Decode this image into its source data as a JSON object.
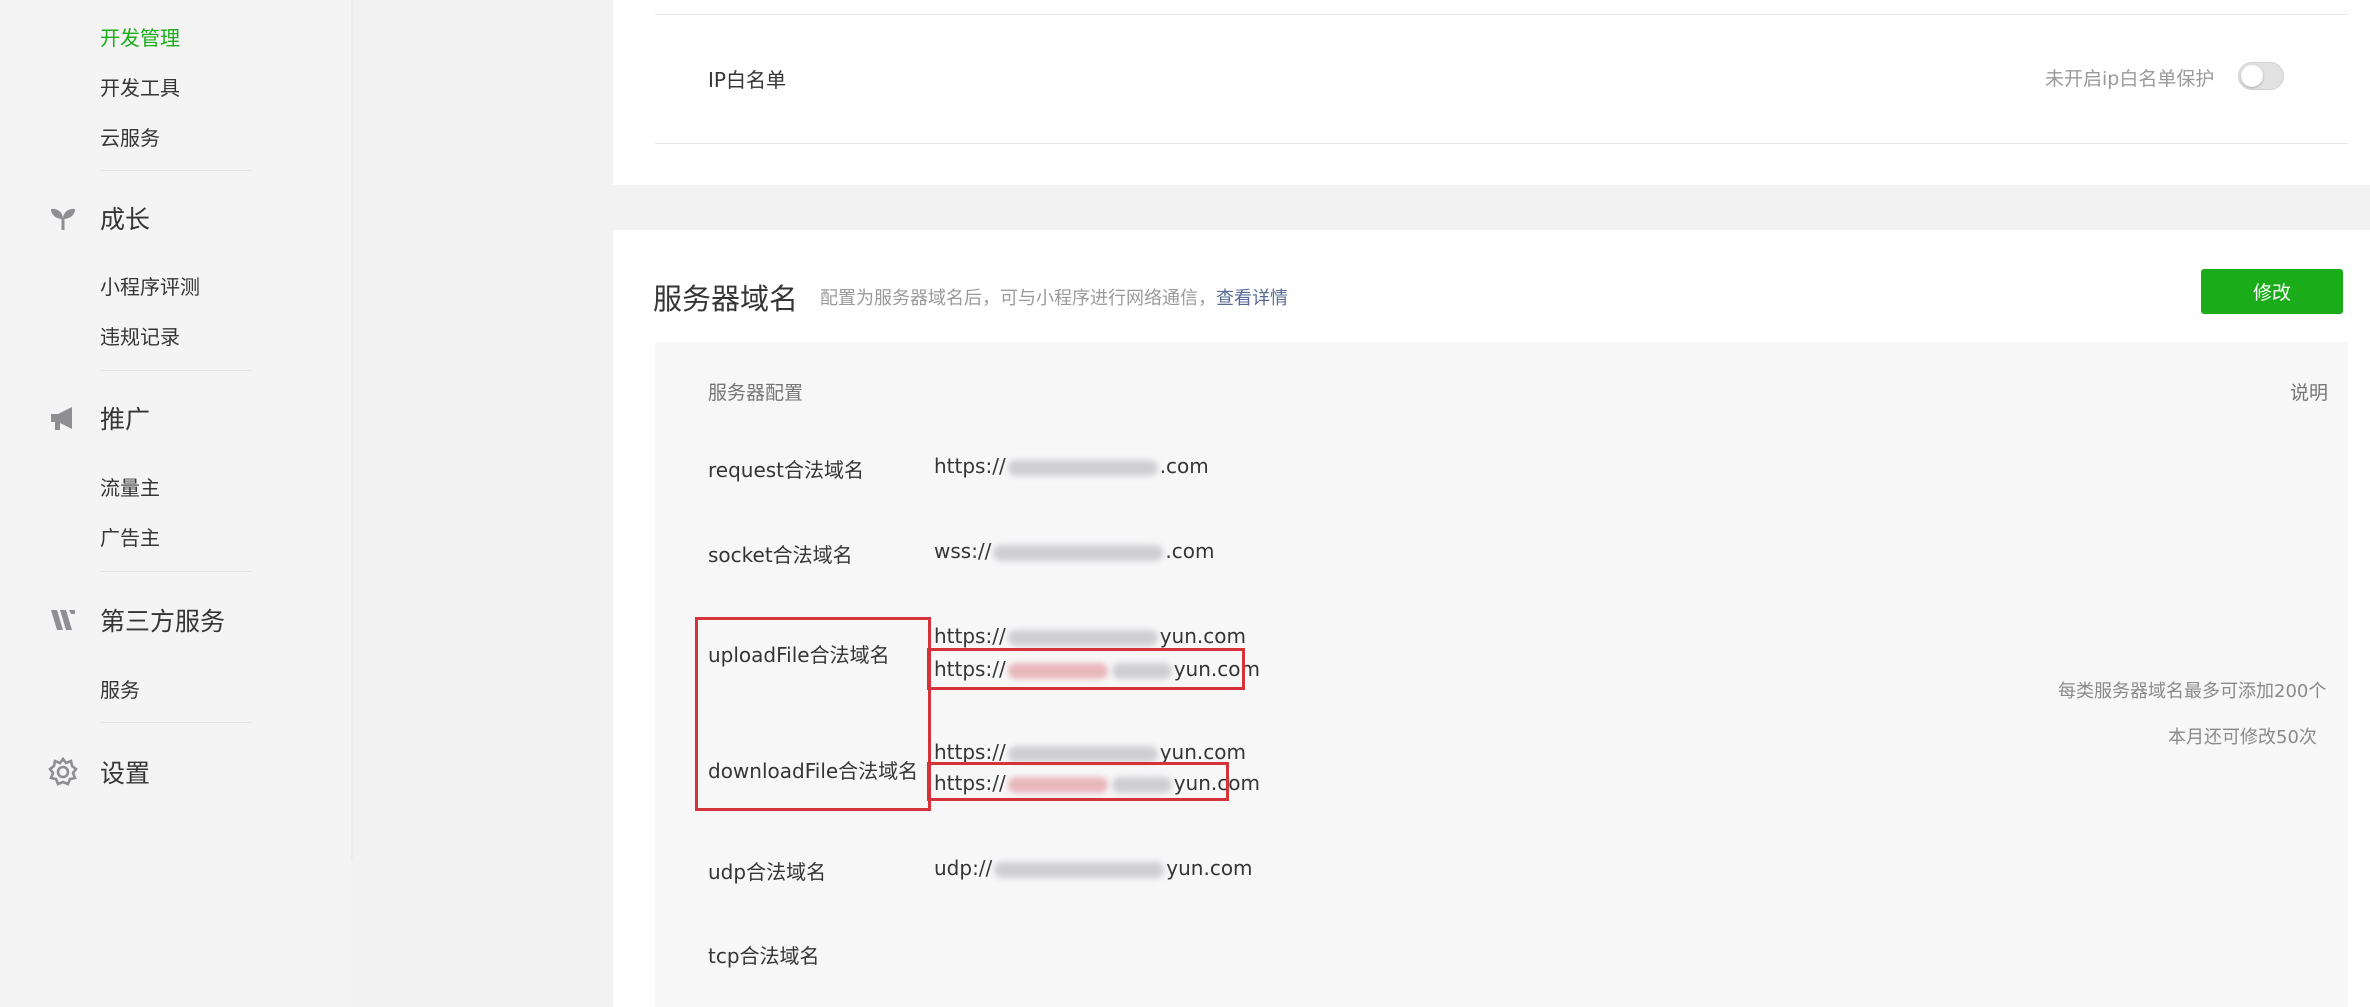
{
  "sidebar": {
    "dev_group": {
      "items": [
        {
          "label": "开发管理",
          "active": true
        },
        {
          "label": "开发工具",
          "active": false
        },
        {
          "label": "云服务",
          "active": false
        }
      ]
    },
    "growth": {
      "label": "成长",
      "icon": "sprout-icon",
      "items": [
        {
          "label": "小程序评测"
        },
        {
          "label": "违规记录"
        }
      ]
    },
    "promotion": {
      "label": "推广",
      "icon": "megaphone-icon",
      "items": [
        {
          "label": "流量主"
        },
        {
          "label": "广告主"
        }
      ]
    },
    "third_party": {
      "label": "第三方服务",
      "icon": "third-party-icon",
      "items": [
        {
          "label": "服务"
        }
      ]
    },
    "settings": {
      "label": "设置",
      "icon": "gear-icon"
    }
  },
  "ip_whitelist": {
    "label": "IP白名单",
    "status_text": "未开启ip白名单保护",
    "enabled": false
  },
  "server_domain": {
    "title": "服务器域名",
    "description": "配置为服务器域名后，可与小程序进行网络通信，",
    "details_link": "查看详情",
    "edit_button": "修改",
    "header_config": "服务器配置",
    "header_notes": "说明",
    "rows": [
      {
        "label": "request合法域名",
        "values": [
          {
            "prefix": "https://",
            "suffix": ".com"
          }
        ]
      },
      {
        "label": "socket合法域名",
        "values": [
          {
            "prefix": "wss://",
            "suffix": ".com"
          }
        ]
      },
      {
        "label": "uploadFile合法域名",
        "values": [
          {
            "prefix": "https://",
            "suffix": "yun.com"
          },
          {
            "prefix": "https://",
            "suffix": "yun.com"
          }
        ]
      },
      {
        "label": "downloadFile合法域名",
        "values": [
          {
            "prefix": "https://",
            "suffix": "yun.com"
          },
          {
            "prefix": "https://",
            "suffix": "yun.com"
          }
        ]
      },
      {
        "label": "udp合法域名",
        "values": [
          {
            "prefix": "udp://",
            "suffix": "yun.com"
          }
        ]
      },
      {
        "label": "tcp合法域名",
        "values": []
      }
    ],
    "notes": [
      "每类服务器域名最多可添加200个",
      "本月还可修改50次"
    ]
  },
  "colors": {
    "accent": "#1aad19",
    "link": "#576b95",
    "highlight_box": "#d5333a"
  }
}
